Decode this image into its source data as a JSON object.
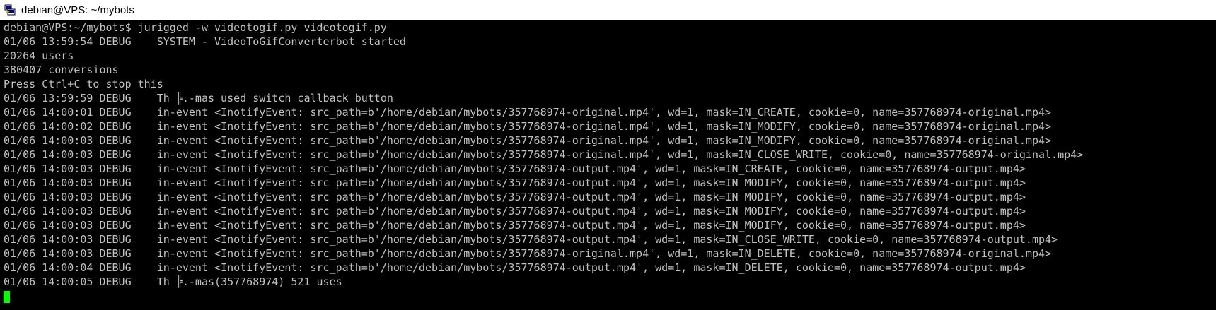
{
  "window": {
    "title": "debian@VPS: ~/mybots",
    "icon": "putty-icon"
  },
  "terminal": {
    "lines": [
      "debian@VPS:~/mybots$ jurigged -w videotogif.py videotogif.py",
      "01/06 13:59:54 DEBUG    SYSTEM - VideoToGifConverterbot started",
      "20264 users",
      "380407 conversions",
      "Press Ctrl+C to stop this",
      "01/06 13:59:59 DEBUG    Th ╠.-mas used switch callback button",
      "01/06 14:00:01 DEBUG    in-event <InotifyEvent: src_path=b'/home/debian/mybots/357768974-original.mp4', wd=1, mask=IN_CREATE, cookie=0, name=357768974-original.mp4>",
      "01/06 14:00:02 DEBUG    in-event <InotifyEvent: src_path=b'/home/debian/mybots/357768974-original.mp4', wd=1, mask=IN_MODIFY, cookie=0, name=357768974-original.mp4>",
      "01/06 14:00:03 DEBUG    in-event <InotifyEvent: src_path=b'/home/debian/mybots/357768974-original.mp4', wd=1, mask=IN_MODIFY, cookie=0, name=357768974-original.mp4>",
      "01/06 14:00:03 DEBUG    in-event <InotifyEvent: src_path=b'/home/debian/mybots/357768974-original.mp4', wd=1, mask=IN_CLOSE_WRITE, cookie=0, name=357768974-original.mp4>",
      "01/06 14:00:03 DEBUG    in-event <InotifyEvent: src_path=b'/home/debian/mybots/357768974-output.mp4', wd=1, mask=IN_CREATE, cookie=0, name=357768974-output.mp4>",
      "01/06 14:00:03 DEBUG    in-event <InotifyEvent: src_path=b'/home/debian/mybots/357768974-output.mp4', wd=1, mask=IN_MODIFY, cookie=0, name=357768974-output.mp4>",
      "01/06 14:00:03 DEBUG    in-event <InotifyEvent: src_path=b'/home/debian/mybots/357768974-output.mp4', wd=1, mask=IN_MODIFY, cookie=0, name=357768974-output.mp4>",
      "01/06 14:00:03 DEBUG    in-event <InotifyEvent: src_path=b'/home/debian/mybots/357768974-output.mp4', wd=1, mask=IN_MODIFY, cookie=0, name=357768974-output.mp4>",
      "01/06 14:00:03 DEBUG    in-event <InotifyEvent: src_path=b'/home/debian/mybots/357768974-output.mp4', wd=1, mask=IN_MODIFY, cookie=0, name=357768974-output.mp4>",
      "01/06 14:00:03 DEBUG    in-event <InotifyEvent: src_path=b'/home/debian/mybots/357768974-output.mp4', wd=1, mask=IN_CLOSE_WRITE, cookie=0, name=357768974-output.mp4>",
      "01/06 14:00:03 DEBUG    in-event <InotifyEvent: src_path=b'/home/debian/mybots/357768974-original.mp4', wd=1, mask=IN_DELETE, cookie=0, name=357768974-original.mp4>",
      "01/06 14:00:04 DEBUG    in-event <InotifyEvent: src_path=b'/home/debian/mybots/357768974-output.mp4', wd=1, mask=IN_DELETE, cookie=0, name=357768974-output.mp4>",
      "01/06 14:00:05 DEBUG    Th ╠.-mas(357768974) 521 uses"
    ],
    "text_color": "#c0c0c0",
    "cursor_color": "#00ff00",
    "background": "#000000"
  }
}
